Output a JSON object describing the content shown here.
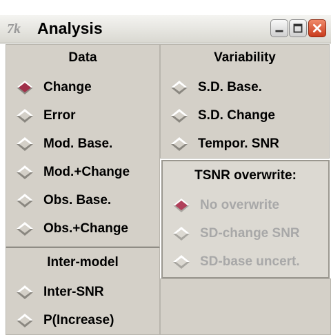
{
  "window": {
    "title": "Analysis",
    "app_icon": "tk-feather-icon",
    "controls": [
      "minimize",
      "maximize",
      "close"
    ]
  },
  "data_panel": {
    "heading": "Data",
    "options": [
      {
        "label": "Change",
        "selected": true
      },
      {
        "label": "Error",
        "selected": false
      },
      {
        "label": "Mod. Base.",
        "selected": false
      },
      {
        "label": "Mod.+Change",
        "selected": false
      },
      {
        "label": "Obs. Base.",
        "selected": false
      },
      {
        "label": "Obs.+Change",
        "selected": false
      }
    ]
  },
  "inter_model_panel": {
    "heading": "Inter-model",
    "options": [
      {
        "label": "Inter-SNR",
        "selected": false
      },
      {
        "label": "P(Increase)",
        "selected": false
      }
    ]
  },
  "variability_panel": {
    "heading": "Variability",
    "options": [
      {
        "label": "S.D. Base.",
        "selected": false
      },
      {
        "label": "S.D. Change",
        "selected": false
      },
      {
        "label": "Tempor. SNR",
        "selected": false
      }
    ]
  },
  "tsnr_panel": {
    "heading": "TSNR overwrite:",
    "disabled": true,
    "options": [
      {
        "label": "No overwrite",
        "selected": true
      },
      {
        "label": "SD-change SNR",
        "selected": false
      },
      {
        "label": "SD-base uncert.",
        "selected": false
      }
    ]
  },
  "colors": {
    "selected_diamond": "#a0304a",
    "selected_diamond_disabled": "#b0405a",
    "panel_bg": "#d4d0c8",
    "disabled_text": "#a8a8a8"
  }
}
